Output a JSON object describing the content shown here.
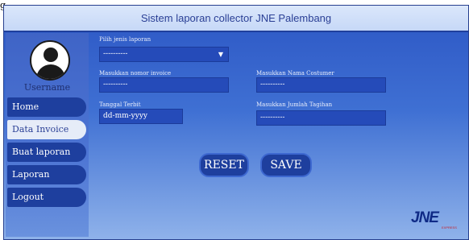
{
  "caption": "g",
  "header": {
    "title": "Sistem laporan collector JNE Palembang"
  },
  "sidebar": {
    "username": "Username",
    "items": [
      {
        "label": "Home"
      },
      {
        "label": "Data Invoice"
      },
      {
        "label": "Buat laporan"
      },
      {
        "label": "Laporan"
      },
      {
        "label": "Logout"
      }
    ],
    "active_index": 1
  },
  "form": {
    "report_type": {
      "label": "Pilih jenis laporan",
      "value": "----------"
    },
    "invoice": {
      "label": "Masukkan nomor invoice",
      "value": "----------"
    },
    "customer": {
      "label": "Masukkan Nama Costumer",
      "value": "----------"
    },
    "date": {
      "label": "Tanggal Terbit",
      "value": "dd-mm-yyyy"
    },
    "amount": {
      "label": "Masukkan Jumlah Tagihan",
      "value": "----------"
    }
  },
  "buttons": {
    "reset": "RESET",
    "save": "SAVE"
  },
  "logo": {
    "main": "JNE",
    "tagline": "EXPRESS"
  },
  "colors": {
    "accent": "#1e3f9e",
    "header_text": "#2a3f95",
    "logo_red": "#c8202a"
  }
}
